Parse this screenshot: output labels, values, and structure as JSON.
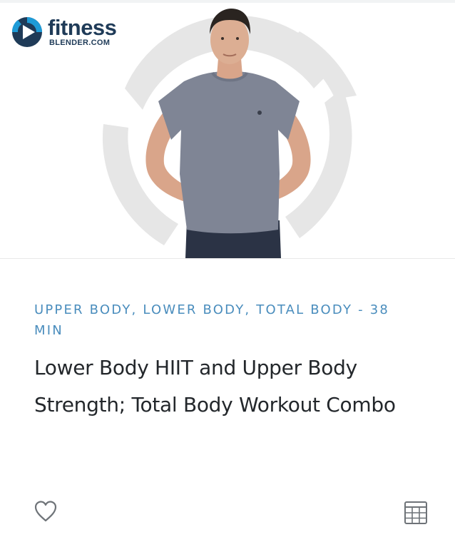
{
  "thumbnail": {
    "logo": {
      "word": "fitness",
      "sub": "BLENDER.COM"
    }
  },
  "workout": {
    "category_line": "UPPER BODY, LOWER BODY, TOTAL BODY - 38 MIN",
    "title": "Lower Body HIIT and Upper Body Strength; Total Body Workout Combo"
  },
  "actions": {
    "favorite_icon": "heart-outline-icon",
    "calendar_icon": "calendar-grid-icon"
  },
  "colors": {
    "accent": "#4a8dbd",
    "title": "#23272b",
    "logo_navy": "#1f3b58",
    "logo_blue": "#1e9bd7",
    "swirl": "#e6e6e6",
    "icon": "#6e7378"
  }
}
